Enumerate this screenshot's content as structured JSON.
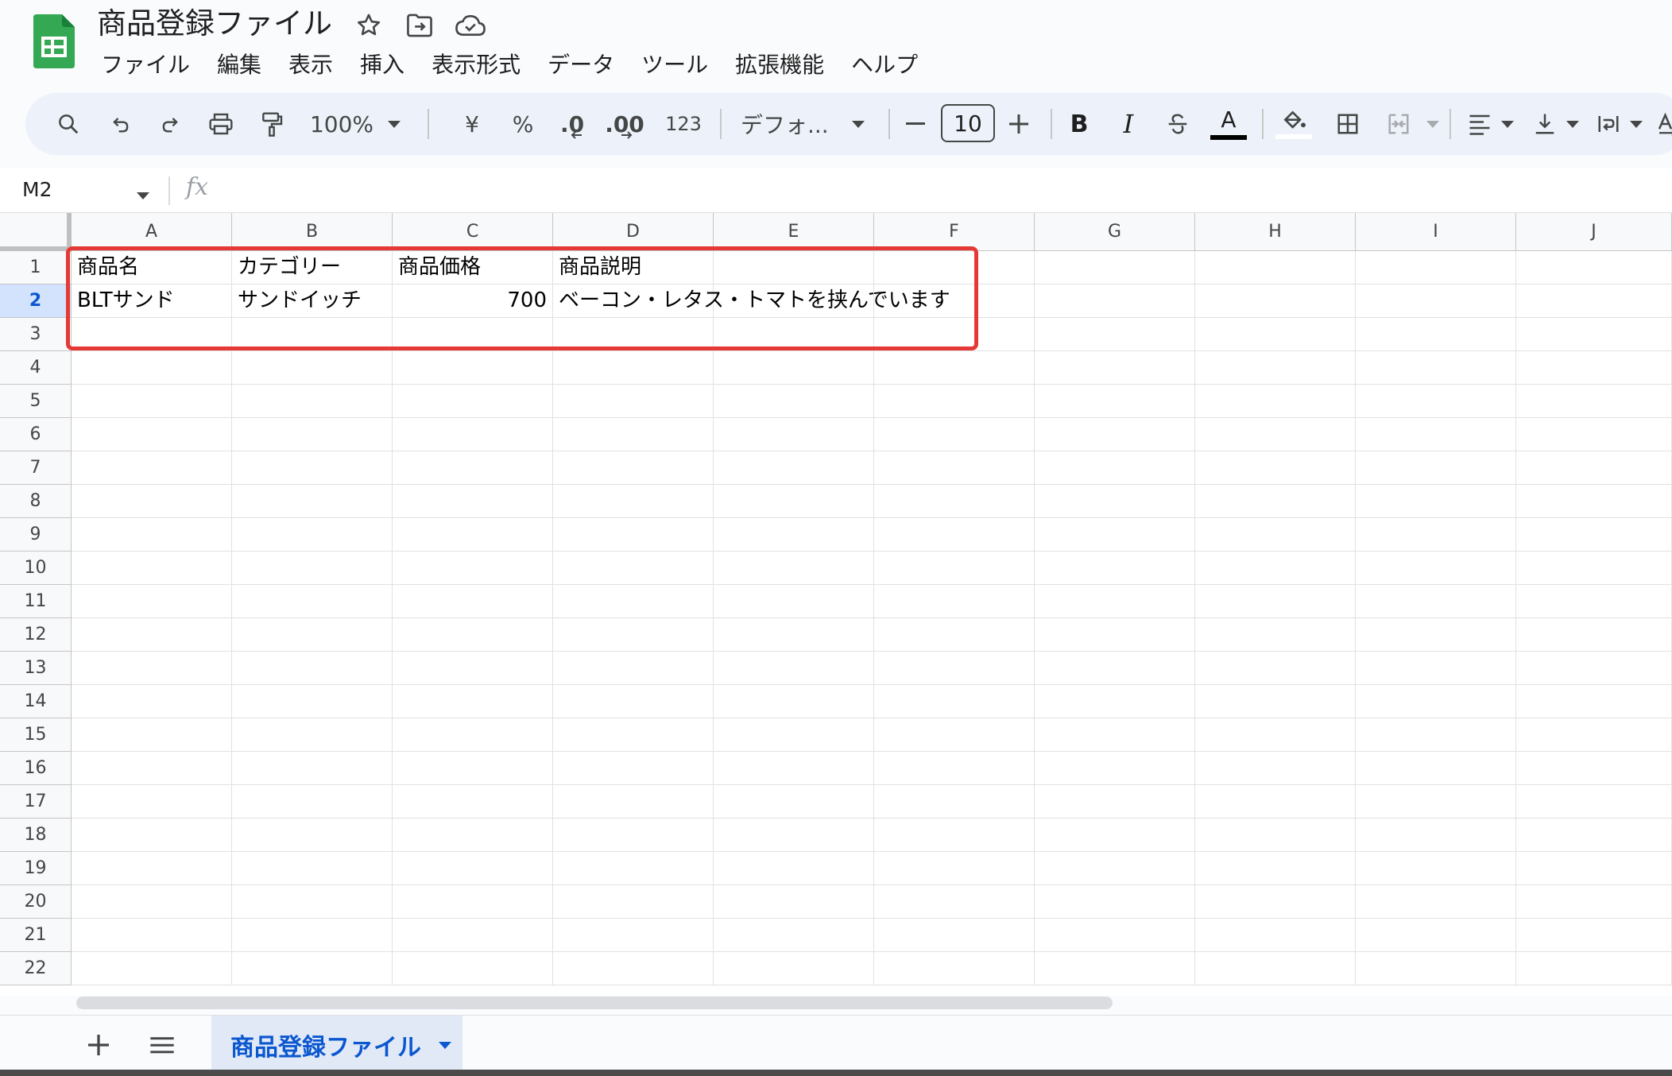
{
  "app": {
    "title": "商品登録ファイル",
    "icons": [
      "sheets-logo-icon",
      "star-icon",
      "move-to-folder-icon",
      "cloud-saved-icon"
    ]
  },
  "menu": [
    "ファイル",
    "編集",
    "表示",
    "挿入",
    "表示形式",
    "データ",
    "ツール",
    "拡張機能",
    "ヘルプ"
  ],
  "toolbar": {
    "zoom": "100%",
    "currency": "¥",
    "percent": "%",
    "decrease_decimal": ".0",
    "increase_decimal": ".00",
    "number_format": "123",
    "font": "デフォ...",
    "font_size": "10",
    "bold": "B",
    "italic": "I",
    "text_color": "A",
    "accent": "#0b57d0"
  },
  "formula_bar": {
    "name_box": "M2",
    "fx": "fx",
    "content": ""
  },
  "grid": {
    "columns": [
      "A",
      "B",
      "C",
      "D",
      "E",
      "F",
      "G",
      "H",
      "I",
      "J"
    ],
    "rows": [
      "1",
      "2",
      "3",
      "4",
      "5",
      "6",
      "7",
      "8",
      "9",
      "10",
      "11",
      "12",
      "13",
      "14",
      "15",
      "16",
      "17",
      "18",
      "19",
      "20",
      "21",
      "22"
    ],
    "selected_row": "2",
    "cells": {
      "A1": "商品名",
      "B1": "カテゴリー",
      "C1": "商品価格",
      "D1": "商品説明",
      "A2": "BLTサンド",
      "B2": "サンドイッチ",
      "C2": "700",
      "D2": "ベーコン・レタス・トマトを挟んでいます"
    },
    "highlight_color": "#e53935"
  },
  "sheets": {
    "tabs": [
      {
        "label": "商品登録ファイル",
        "active": true
      }
    ]
  }
}
